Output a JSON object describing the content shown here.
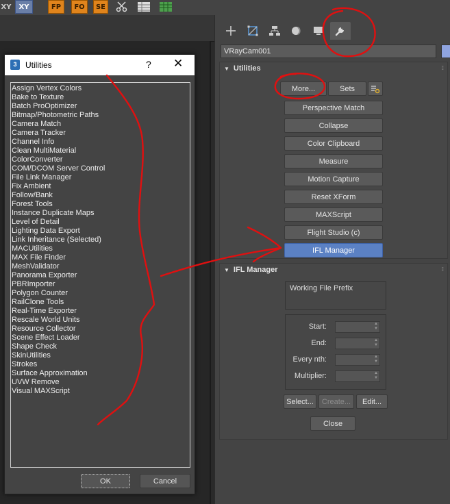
{
  "top_toolbar": {
    "items": [
      {
        "label": "XY",
        "name": "xy-partial-button"
      },
      {
        "label": "XY",
        "name": "xy-axis-button"
      },
      {
        "label": "FP",
        "name": "fp-button"
      },
      {
        "label": "FO",
        "name": "fo-button"
      },
      {
        "label": "SE",
        "name": "se-button"
      }
    ]
  },
  "command_panel": {
    "object_name": "VRayCam001",
    "object_color": "#8fa4e0",
    "tabs": [
      {
        "icon": "create-icon"
      },
      {
        "icon": "modify-icon"
      },
      {
        "icon": "hierarchy-icon"
      },
      {
        "icon": "motion-icon"
      },
      {
        "icon": "display-icon"
      },
      {
        "icon": "utilities-icon"
      }
    ],
    "utilities_rollout": {
      "title": "Utilities",
      "more_label": "More...",
      "sets_label": "Sets",
      "buttons": [
        "Perspective Match",
        "Collapse",
        "Color Clipboard",
        "Measure",
        "Motion Capture",
        "Reset XForm",
        "MAXScript",
        "Flight Studio (c)",
        "IFL Manager"
      ],
      "selected_index": 8
    },
    "ifl_rollout": {
      "title": "IFL Manager",
      "prefix_label": "Working File Prefix",
      "fields": [
        "Start:",
        "End:",
        "Every nth:",
        "Multiplier:"
      ],
      "select_label": "Select...",
      "create_label": "Create...",
      "edit_label": "Edit...",
      "close_label": "Close"
    }
  },
  "dialog": {
    "title": "Utilities",
    "app_badge": "3",
    "help_glyph": "?",
    "close_glyph": "✕",
    "items": [
      "Assign Vertex Colors",
      "Bake to Texture",
      "Batch ProOptimizer",
      "Bitmap/Photometric Paths",
      "Camera Match",
      "Camera Tracker",
      "Channel Info",
      "Clean MultiMaterial",
      "ColorConverter",
      "COM/DCOM Server Control",
      "File Link Manager",
      "Fix Ambient",
      "Follow/Bank",
      "Forest Tools",
      "Instance Duplicate Maps",
      "Level of Detail",
      "Lighting Data Export",
      "Link Inheritance (Selected)",
      "MACUtilities",
      "MAX File Finder",
      "MeshValidator",
      "Panorama Exporter",
      "PBRImporter",
      "Polygon Counter",
      "RailClone Tools",
      "Real-Time Exporter",
      "Rescale World Units",
      "Resource Collector",
      "Scene Effect Loader",
      "Shape Check",
      "SkinUtilities",
      "Strokes",
      "Surface Approximation",
      "UVW Remove",
      "Visual MAXScript"
    ],
    "ok_label": "OK",
    "cancel_label": "Cancel"
  },
  "annotation_color": "#e01010"
}
